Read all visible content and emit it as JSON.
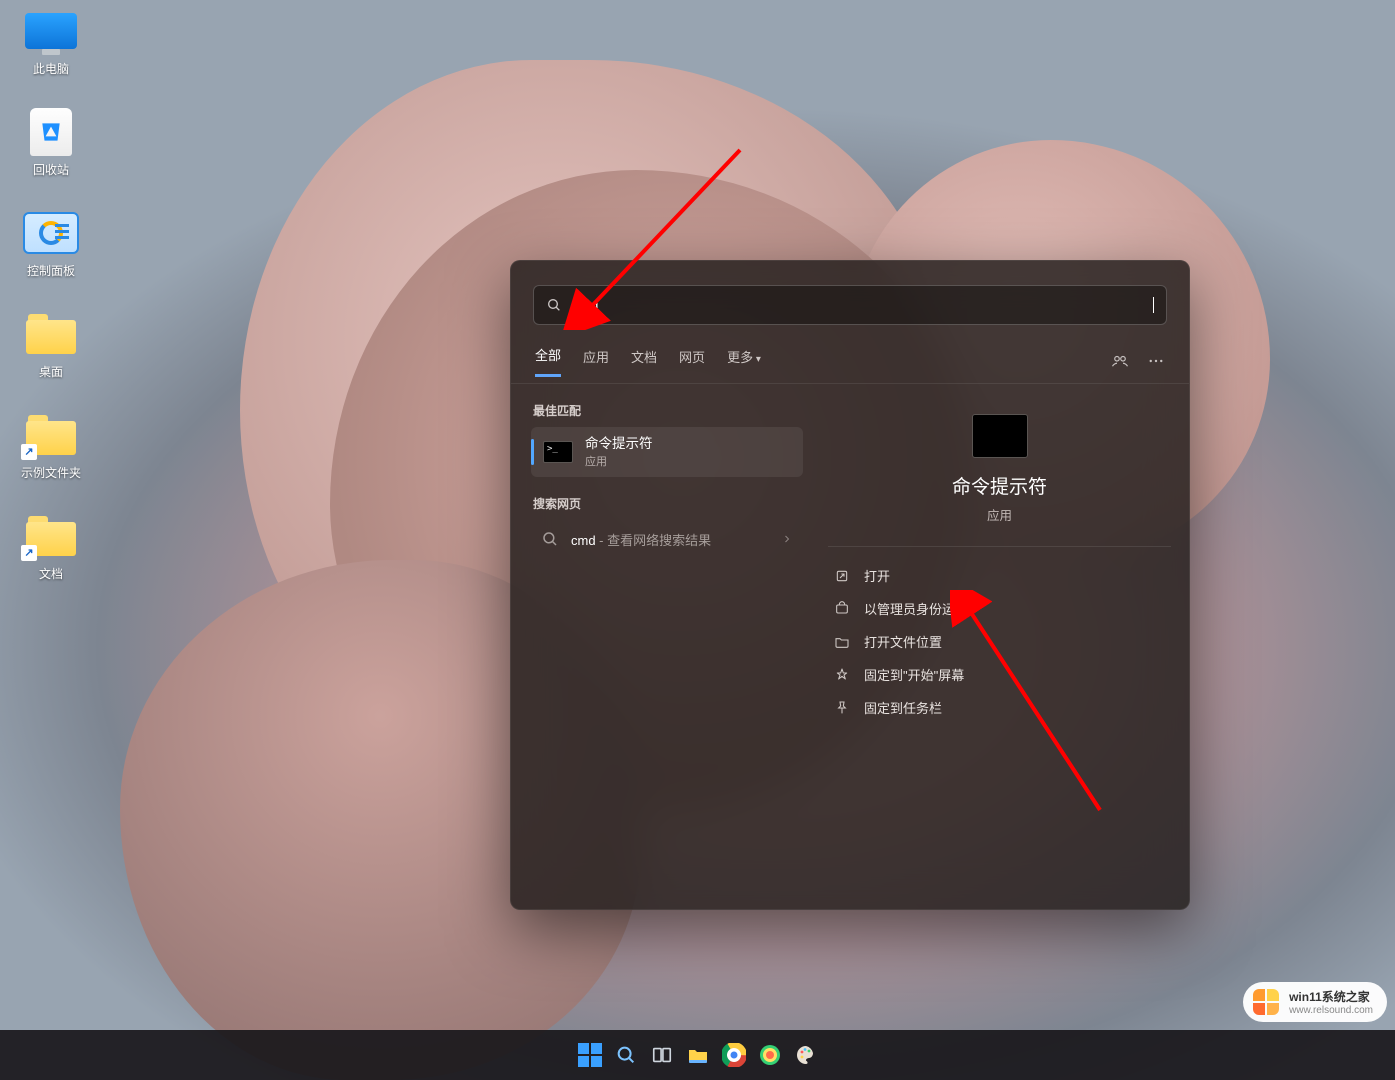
{
  "desktop": {
    "icons": [
      {
        "name": "this-pc",
        "label": "此电脑"
      },
      {
        "name": "recycle-bin",
        "label": "回收站"
      },
      {
        "name": "control-panel",
        "label": "控制面板"
      },
      {
        "name": "folder-1",
        "label": "桌面"
      },
      {
        "name": "folder-2",
        "label": "示例文件夹"
      },
      {
        "name": "folder-3",
        "label": "文档"
      }
    ]
  },
  "search": {
    "query": "cmd",
    "tabs": {
      "all": "全部",
      "apps": "应用",
      "docs": "文档",
      "web": "网页",
      "more": "更多"
    },
    "best_match_label": "最佳匹配",
    "best_match": {
      "title": "命令提示符",
      "subtitle": "应用"
    },
    "web_section_label": "搜索网页",
    "web_result": {
      "query": "cmd",
      "hint": " - 查看网络搜索结果"
    },
    "detail": {
      "title": "命令提示符",
      "subtitle": "应用"
    },
    "actions": [
      {
        "icon": "open",
        "label": "打开"
      },
      {
        "icon": "admin",
        "label": "以管理员身份运行"
      },
      {
        "icon": "folder",
        "label": "打开文件位置"
      },
      {
        "icon": "pin-start",
        "label": "固定到\"开始\"屏幕"
      },
      {
        "icon": "pin-task",
        "label": "固定到任务栏"
      }
    ]
  },
  "watermark": {
    "line1": "win11系统之家",
    "line2": "www.relsound.com"
  }
}
